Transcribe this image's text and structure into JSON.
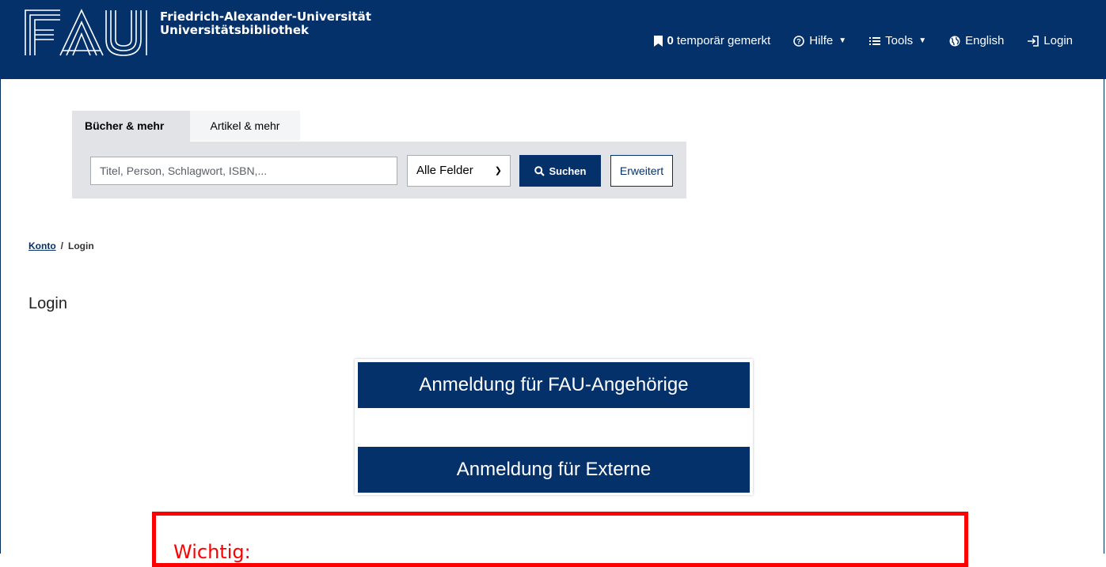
{
  "header": {
    "logo_text": "FAU",
    "university_line1": "Friedrich-Alexander-Universität",
    "university_line2": "Universitätsbibliothek",
    "nav": {
      "saved_count": "0",
      "saved_label": "temporär gemerkt",
      "help_label": "Hilfe",
      "tools_label": "Tools",
      "language_label": "English",
      "login_label": "Login"
    }
  },
  "search": {
    "tabs": [
      {
        "label": "Bücher & mehr",
        "active": true
      },
      {
        "label": "Artikel & mehr",
        "active": false
      }
    ],
    "input_placeholder": "Titel, Person, Schlagwort, ISBN,...",
    "field_select_value": "Alle Felder",
    "search_button_label": "Suchen",
    "advanced_button_label": "Erweitert"
  },
  "breadcrumb": {
    "parent": "Konto",
    "separator": "/",
    "current": "Login"
  },
  "page": {
    "title": "Login",
    "login_fau_label": "Anmeldung für FAU-Angehörige",
    "login_external_label": "Anmeldung für Externe",
    "notice_heading": "Wichtig:"
  },
  "colors": {
    "brand": "#04316a",
    "panel": "#e1e3e6",
    "notice": "#ff0000"
  }
}
